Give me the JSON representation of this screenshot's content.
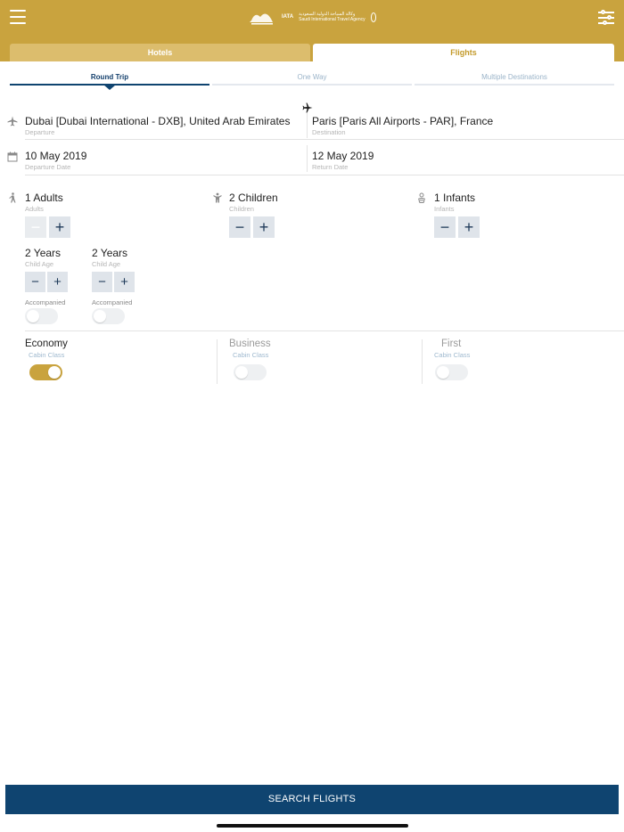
{
  "header": {
    "logo_text_line1": "وكالة السياحة الدولية السعودية",
    "logo_text_line2": "Saudi International Travel Agency",
    "logo_brand": "IATA",
    "colors": {
      "gold": "#c9a33e",
      "navy": "#0f4470"
    },
    "icons": {
      "menu": "menu-icon",
      "filter": "filter-sliders-icon"
    }
  },
  "main_tabs": [
    {
      "label": "Hotels",
      "active": false
    },
    {
      "label": "Flights",
      "active": true
    }
  ],
  "trip_tabs": [
    {
      "label": "Round Trip",
      "active": true
    },
    {
      "label": "One Way",
      "active": false
    },
    {
      "label": "Multiple Destinations",
      "active": false
    }
  ],
  "route": {
    "departure_value": "Dubai [Dubai International - DXB], United Arab Emirates",
    "departure_label": "Departure",
    "destination_value": "Paris [Paris All Airports - PAR], France",
    "destination_label": "Destination"
  },
  "dates": {
    "departure_value": "10 May 2019",
    "departure_label": "Departure Date",
    "return_value": "12 May 2019",
    "return_label": "Return Date"
  },
  "passengers": {
    "adults": {
      "value": "1 Adults",
      "label": "Adults",
      "minus": "−",
      "plus": "+"
    },
    "children": {
      "value": "2 Children",
      "label": "Children",
      "minus": "−",
      "plus": "+"
    },
    "infants": {
      "value": "1 Infants",
      "label": "Infants",
      "minus": "−",
      "plus": "+"
    }
  },
  "child_ages": [
    {
      "value": "2 Years",
      "label": "Child Age",
      "minus": "−",
      "plus": "+",
      "accompanied_label": "Accompanied",
      "accompanied": false
    },
    {
      "value": "2 Years",
      "label": "Child Age",
      "minus": "−",
      "plus": "+",
      "accompanied_label": "Accompanied",
      "accompanied": false
    }
  ],
  "cabin_classes": [
    {
      "title": "Economy",
      "label": "Cabin Class",
      "selected": true
    },
    {
      "title": "Business",
      "label": "Cabin Class",
      "selected": false
    },
    {
      "title": "First",
      "label": "Cabin Class",
      "selected": false
    }
  ],
  "search_button": "SEARCH FLIGHTS"
}
